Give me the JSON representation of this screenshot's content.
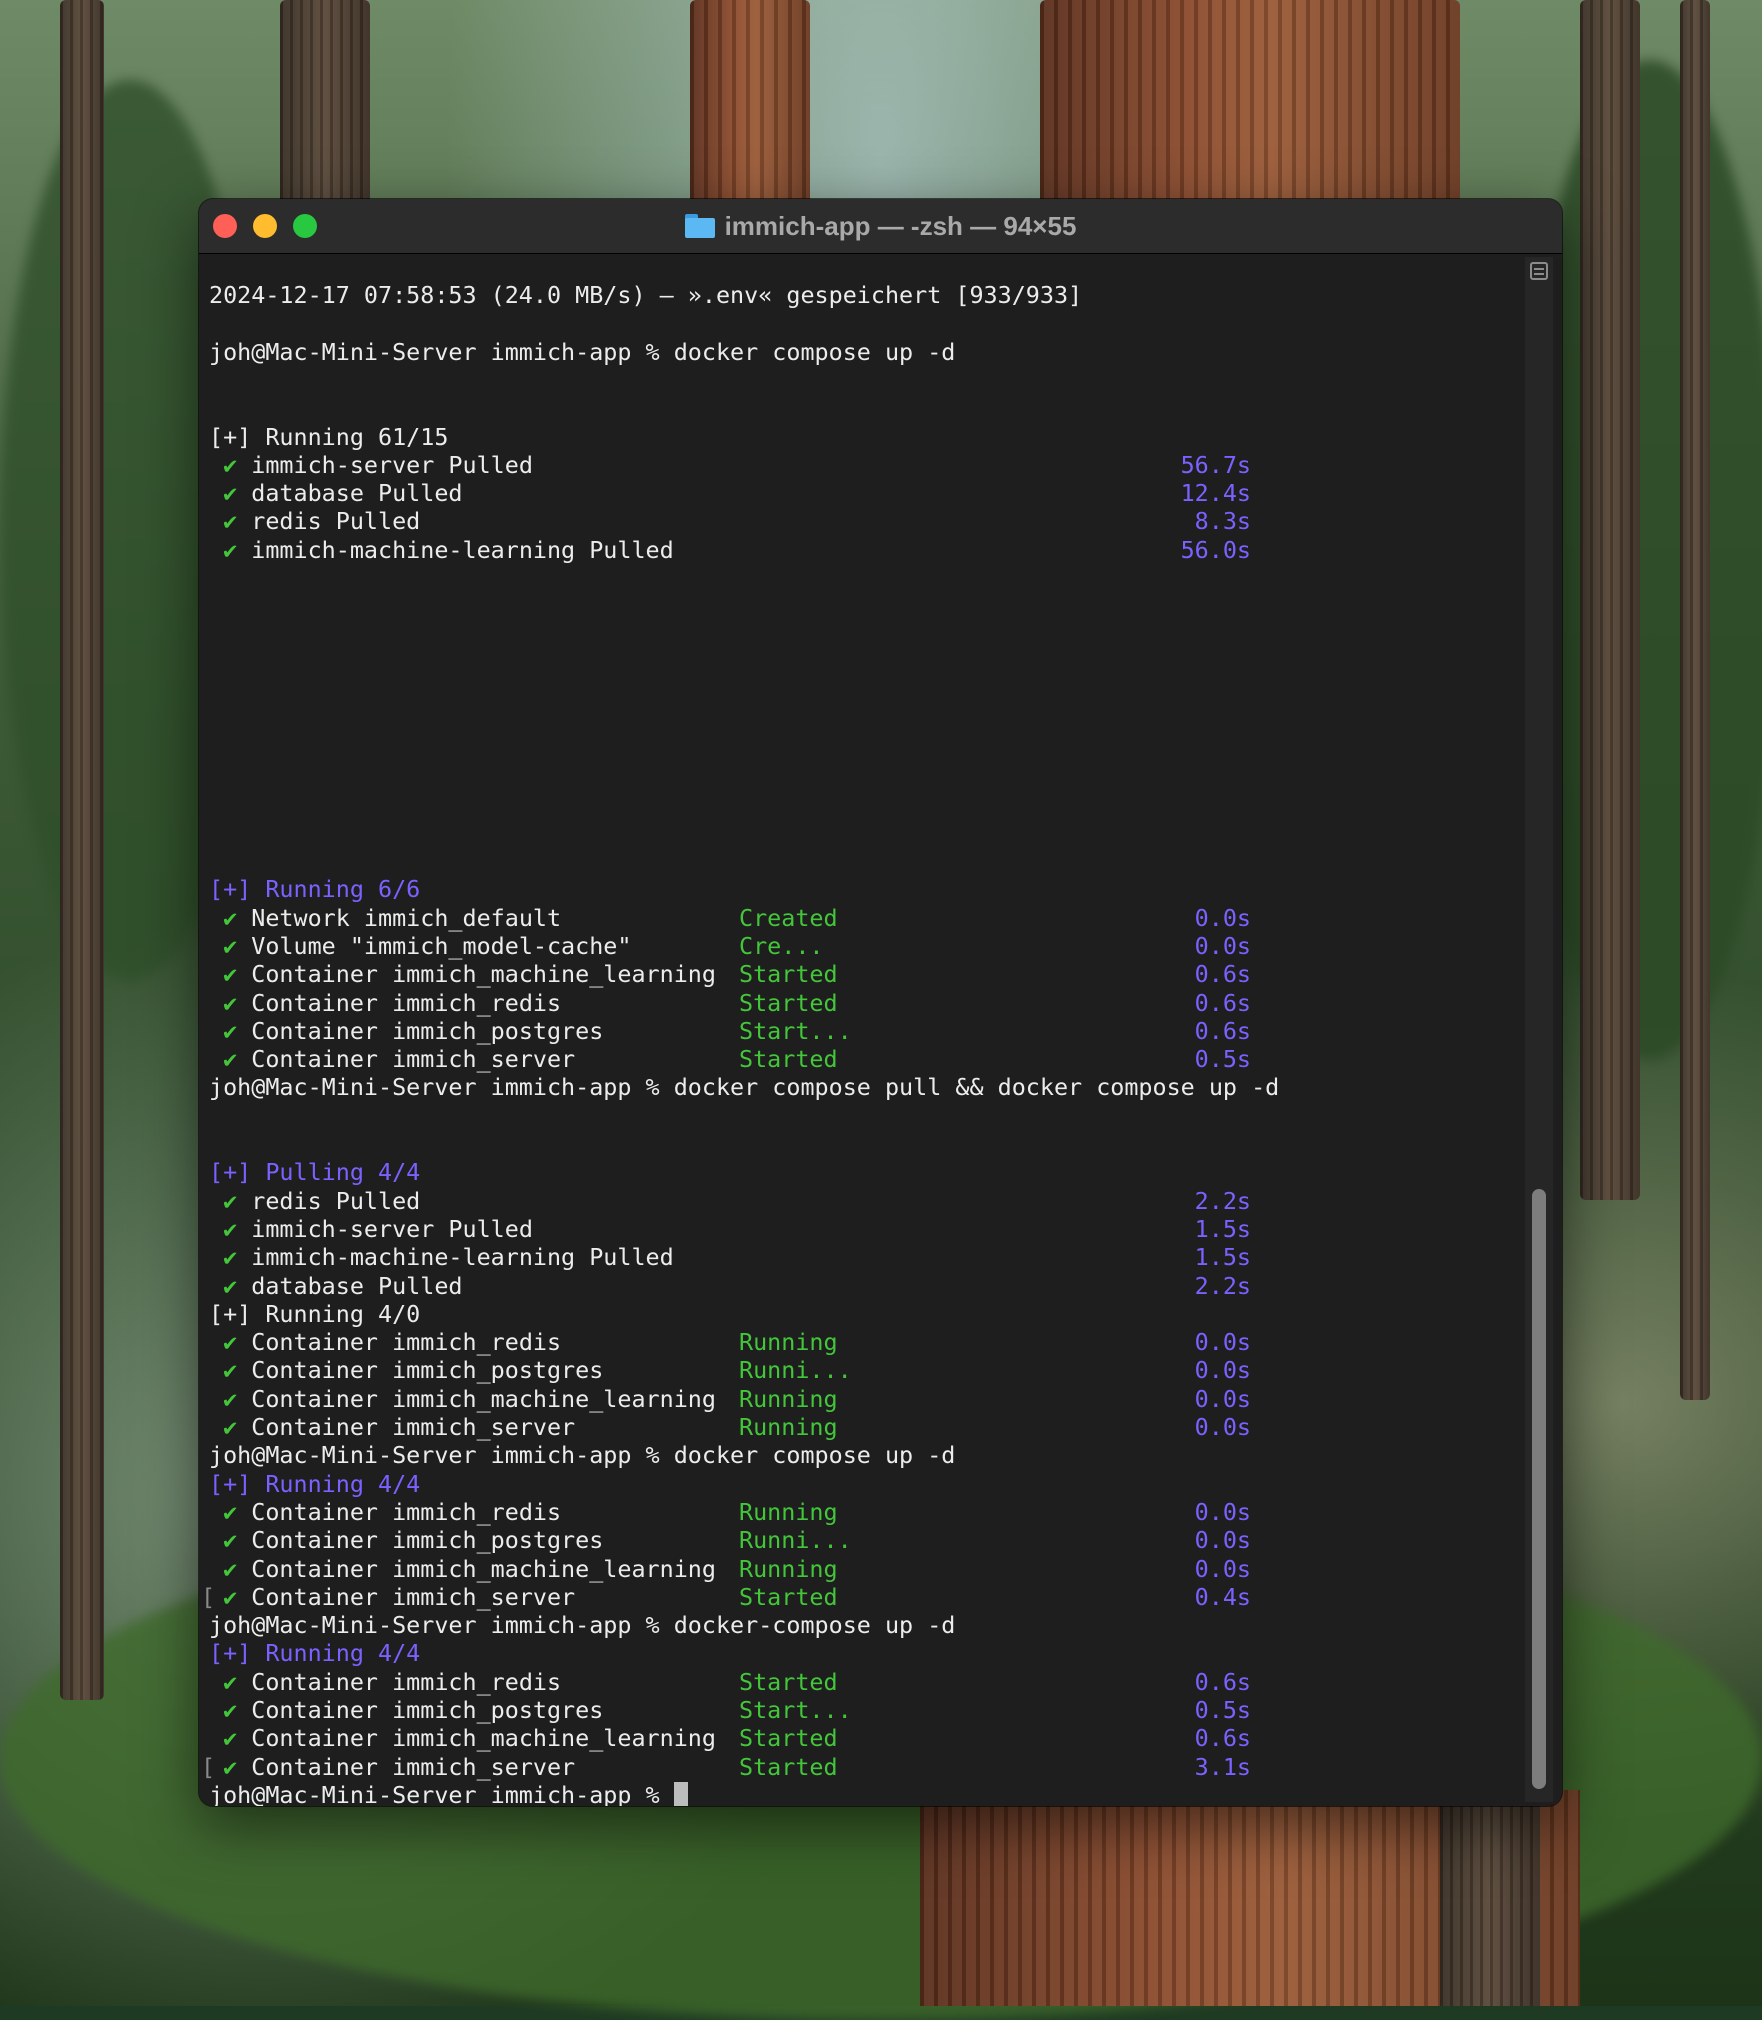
{
  "window": {
    "title": "immich-app — -zsh — 94×55"
  },
  "terminal": {
    "lines": [
      {
        "text": "2024-12-17 07:58:53 (24.0 MB/s) – ».env« gespeichert [933/933]"
      },
      {
        "text": "joh@Mac-Mini-Server immich-app % docker compose up -d"
      },
      {
        "text": "[+] Running 61/15"
      },
      {
        "text": "immich-server Pulled",
        "time": "56.7s"
      },
      {
        "text": "database Pulled",
        "time": "12.4s"
      },
      {
        "text": "redis Pulled",
        "time": "8.3s"
      },
      {
        "text": "immich-machine-learning Pulled",
        "time": "56.0s"
      },
      {
        "text": "[+] Running 6/6"
      },
      {
        "text": "Network immich_default",
        "status": "Created",
        "time": "0.0s"
      },
      {
        "text": "Volume \"immich_model-cache\"",
        "status": "Cre...",
        "time": "0.0s"
      },
      {
        "text": "Container immich_machine_learning",
        "status": "Started",
        "time": "0.6s"
      },
      {
        "text": "Container immich_redis",
        "status": "Started",
        "time": "0.6s"
      },
      {
        "text": "Container immich_postgres",
        "status": "Start...",
        "time": "0.6s"
      },
      {
        "text": "Container immich_server",
        "status": "Started",
        "time": "0.5s"
      },
      {
        "text": "joh@Mac-Mini-Server immich-app % docker compose pull && docker compose up -d"
      },
      {
        "text": "[+] Pulling 4/4"
      },
      {
        "text": "redis Pulled",
        "time": "2.2s"
      },
      {
        "text": "immich-server Pulled",
        "time": "1.5s"
      },
      {
        "text": "immich-machine-learning Pulled",
        "time": "1.5s"
      },
      {
        "text": "database Pulled",
        "time": "2.2s"
      },
      {
        "text": "[+] Running 4/0"
      },
      {
        "text": "Container immich_redis",
        "status": "Running",
        "time": "0.0s"
      },
      {
        "text": "Container immich_postgres",
        "status": "Runni...",
        "time": "0.0s"
      },
      {
        "text": "Container immich_machine_learning",
        "status": "Running",
        "time": "0.0s"
      },
      {
        "text": "Container immich_server",
        "status": "Running",
        "time": "0.0s"
      },
      {
        "text": "joh@Mac-Mini-Server immich-app % docker compose up -d"
      },
      {
        "text": "[+] Running 4/4"
      },
      {
        "text": "Container immich_redis",
        "status": "Running",
        "time": "0.0s"
      },
      {
        "text": "Container immich_postgres",
        "status": "Runni...",
        "time": "0.0s"
      },
      {
        "text": "Container immich_machine_learning",
        "status": "Running",
        "time": "0.0s"
      },
      {
        "text": "Container immich_server",
        "status": "Started",
        "time": "0.4s"
      },
      {
        "text": "joh@Mac-Mini-Server immich-app % docker-compose up -d"
      },
      {
        "text": "[+] Running 4/4"
      },
      {
        "text": "Container immich_redis",
        "status": "Started",
        "time": "0.6s"
      },
      {
        "text": "Container immich_postgres",
        "status": "Start...",
        "time": "0.5s"
      },
      {
        "text": "Container immich_machine_learning",
        "status": "Started",
        "time": "0.6s"
      },
      {
        "text": "Container immich_server",
        "status": "Started",
        "time": "3.1s"
      },
      {
        "text": "joh@Mac-Mini-Server immich-app % "
      }
    ],
    "glyphs": {
      "check": "✔",
      "bracket_left": "[",
      "bracket_right": "]"
    }
  },
  "colors": {
    "check": "#43c63a",
    "status": "#43c63a",
    "time": "#7b61ff",
    "header_highlight": "#7b61ff"
  }
}
